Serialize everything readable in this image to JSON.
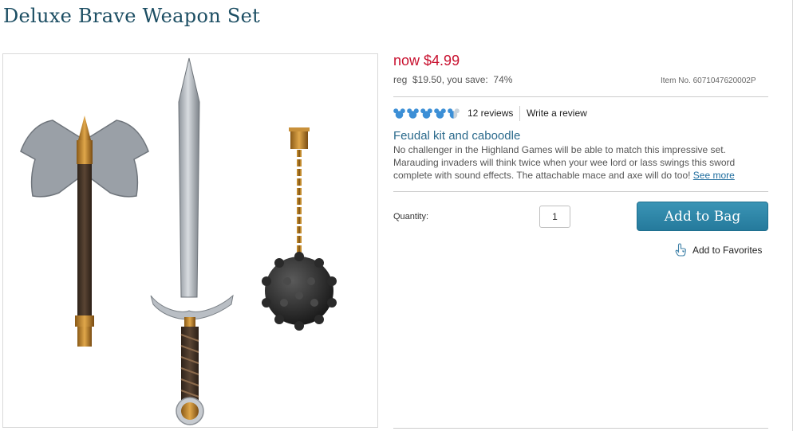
{
  "product": {
    "title": "Deluxe Brave Weapon Set",
    "image_alt": "Deluxe Brave Weapon Set - axe, sword and mace"
  },
  "pricing": {
    "now_label": "now",
    "now_price": "$4.99",
    "reg_line": "reg  $19.50, you save:  74%",
    "item_number": "Item No. 6071047620002P"
  },
  "rating": {
    "icon": "mickey-head-icon",
    "value": 4.5,
    "max": 5,
    "reviews_label": "12 reviews",
    "write_review_label": "Write a review"
  },
  "description": {
    "title": "Feudal kit and caboodle",
    "body": "No challenger in the Highland Games will be able to match this impressive set. Marauding invaders will think twice when your wee lord or lass swings this sword complete with sound effects. The attachable mace and axe will do too!",
    "see_more_label": "See more"
  },
  "purchase": {
    "quantity_label": "Quantity:",
    "quantity_value": "1",
    "add_to_bag_label": "Add to Bag",
    "favorites_label": "Add to Favorites",
    "favorites_icon": "hand-favorite-icon"
  },
  "colors": {
    "title": "#1c4e63",
    "price": "#c8102e",
    "rating_icon": "#3c8fd6",
    "button": "#2a84a7",
    "link": "#2b6a8c"
  }
}
